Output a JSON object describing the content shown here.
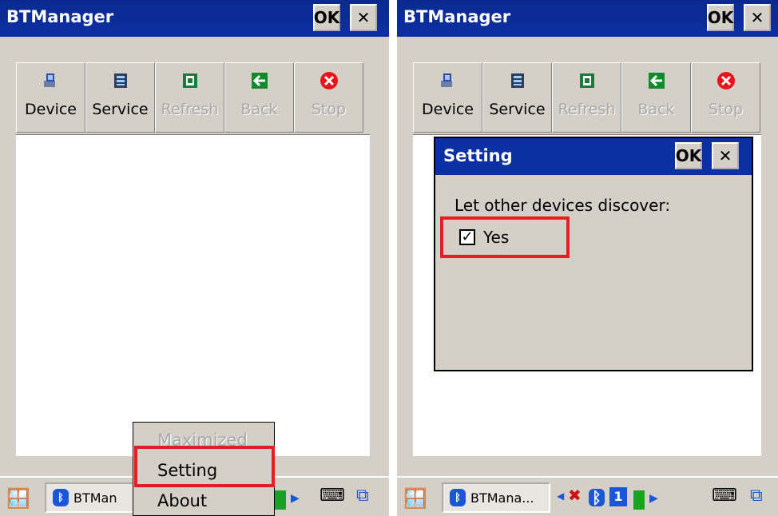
{
  "left_screen": {
    "title": "BTManager",
    "ok_label": "OK",
    "close_label": "✕",
    "toolbar": [
      {
        "label": "Device",
        "icon": "device-icon",
        "enabled": true
      },
      {
        "label": "Service",
        "icon": "service-icon",
        "enabled": true
      },
      {
        "label": "Refresh",
        "icon": "refresh-icon",
        "enabled": false
      },
      {
        "label": "Back",
        "icon": "back-icon",
        "enabled": false
      },
      {
        "label": "Stop",
        "icon": "stop-icon",
        "enabled": false
      }
    ],
    "taskbar_app": "BTMan",
    "popup_menu": [
      {
        "label": "Maximized",
        "enabled": false
      },
      {
        "label": "Setting",
        "enabled": true
      },
      {
        "label": "About",
        "enabled": true
      }
    ]
  },
  "right_screen": {
    "title": "BTManager",
    "ok_label": "OK",
    "close_label": "✕",
    "toolbar": [
      {
        "label": "Device",
        "icon": "device-icon",
        "enabled": true
      },
      {
        "label": "Service",
        "icon": "service-icon",
        "enabled": true
      },
      {
        "label": "Refresh",
        "icon": "refresh-icon",
        "enabled": false
      },
      {
        "label": "Back",
        "icon": "back-icon",
        "enabled": false
      },
      {
        "label": "Stop",
        "icon": "stop-icon",
        "enabled": false
      }
    ],
    "dialog": {
      "title": "Setting",
      "ok_label": "OK",
      "close_label": "✕",
      "prompt": "Let other devices discover:",
      "checkbox_label": "Yes",
      "checked": true
    },
    "taskbar_app": "BTMana...",
    "tray_number": "1"
  },
  "colors": {
    "titlebar": "#0c2fa3",
    "highlight": "#e51e25",
    "chrome": "#d4d0c8"
  }
}
